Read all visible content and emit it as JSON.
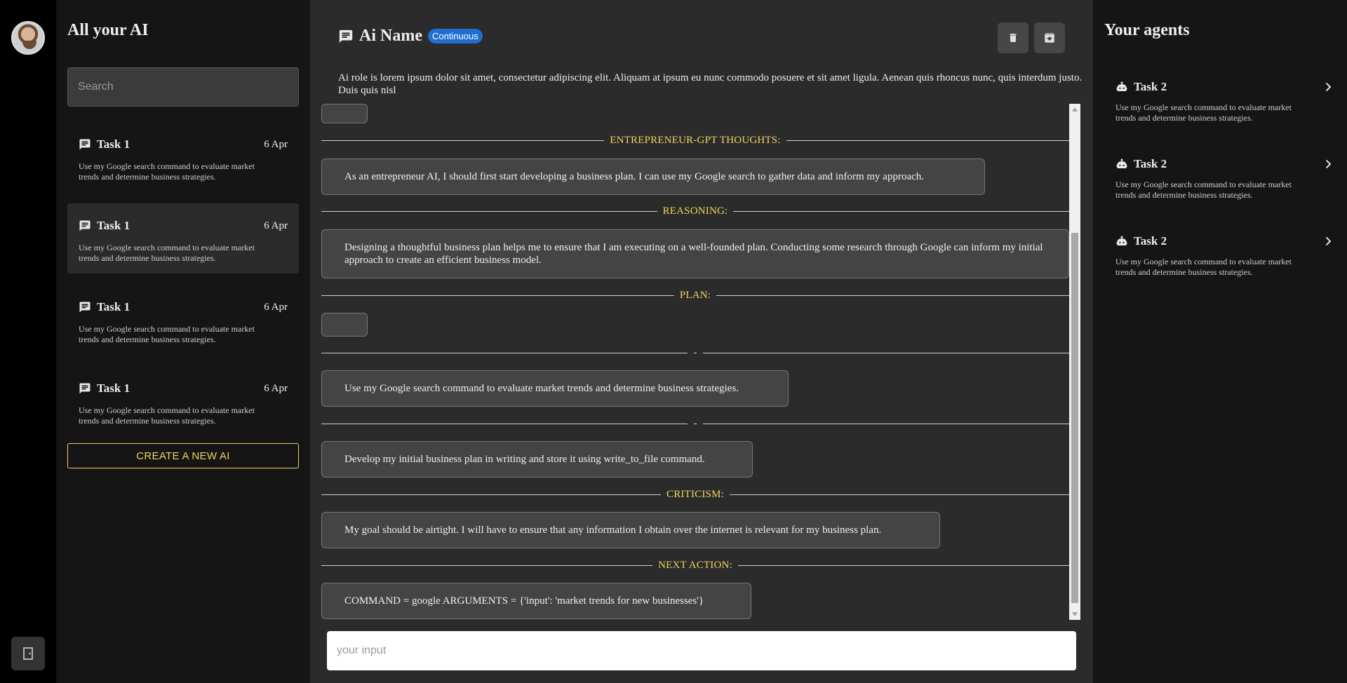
{
  "sidebar": {
    "title": "All your AI",
    "search_placeholder": "Search",
    "tasks": [
      {
        "name": "Task 1",
        "date": "6 Apr",
        "desc": "Use my Google search command to evaluate market trends and determine business strategies."
      },
      {
        "name": "Task 1",
        "date": "6 Apr",
        "desc": "Use my Google search command to evaluate market trends and determine business strategies."
      },
      {
        "name": "Task 1",
        "date": "6 Apr",
        "desc": "Use my Google search command to evaluate market trends and determine business strategies."
      },
      {
        "name": "Task 1",
        "date": "6 Apr",
        "desc": "Use my Google search command to evaluate market trends and determine business strategies."
      }
    ],
    "create_label": "CREATE A NEW AI"
  },
  "header": {
    "ai_name": "Ai Name",
    "badge": "Continuous",
    "role": "Ai role is lorem ipsum dolor sit amet, consectetur adipiscing elit. Aliquam at ipsum eu nunc commodo posuere et sit amet ligula. Aenean quis rhoncus nunc, quis interdum justo. Duis quis nisl"
  },
  "chat": {
    "thoughts_label": "ENTREPRENEUR-GPT THOUGHTS:",
    "thoughts_text": "As an entrepreneur AI, I should first start developing a business plan. I can use my Google search to gather data and inform my approach.",
    "reasoning_label": "REASONING:",
    "reasoning_text": "Designing a thoughtful business plan helps me to ensure that I am executing on a well-founded plan. Conducting some research through Google can inform my initial approach to create an efficient business model.",
    "plan_label": "PLAN:",
    "plan_item_sep": "-",
    "plan_item_1": "Use my Google search command to evaluate market trends and determine business strategies.",
    "plan_item_2": "Develop my initial business plan in writing and store it using write_to_file command.",
    "criticism_label": "CRITICISM:",
    "criticism_text": "My goal should be airtight. I will have to ensure that any information I obtain over the internet is relevant for my business plan.",
    "next_action_label": "NEXT ACTION:",
    "next_action_text": "COMMAND = google ARGUMENTS = {'input': 'market trends for new businesses'}"
  },
  "input_placeholder": "your input",
  "agents": {
    "title": "Your agents",
    "items": [
      {
        "name": "Task 2",
        "desc": "Use my Google search command to evaluate market trends and determine business strategies."
      },
      {
        "name": "Task 2",
        "desc": "Use my Google search command to evaluate market trends and determine business strategies."
      },
      {
        "name": "Task 2",
        "desc": "Use my Google search command to evaluate market trends and determine business strategies."
      }
    ]
  },
  "colors": {
    "accent_yellow": "#f2d35e",
    "badge_blue": "#1f6fd1",
    "main_bg": "#2b2b2b",
    "panel_bg": "#151515"
  },
  "icons": [
    "avatar",
    "logout-icon",
    "chat-icon",
    "delete-icon",
    "archive-icon",
    "robot-icon",
    "chevron-right-icon"
  ]
}
